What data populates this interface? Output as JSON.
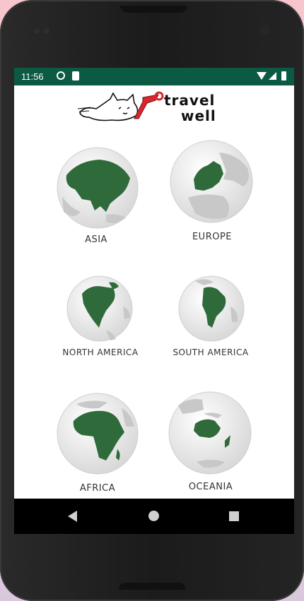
{
  "status_bar": {
    "time": "11:56"
  },
  "logo": {
    "line1": "travel",
    "line2": "well"
  },
  "continents": [
    {
      "id": "asia",
      "label": "ASIA"
    },
    {
      "id": "europe",
      "label": "EUROPE"
    },
    {
      "id": "north-america",
      "label": "NORTH AMERICA"
    },
    {
      "id": "south-america",
      "label": "SOUTH AMERICA"
    },
    {
      "id": "africa",
      "label": "AFRICA"
    },
    {
      "id": "oceania",
      "label": "OCEANIA"
    }
  ],
  "colors": {
    "status_bar": "#0b5a44",
    "land_highlight": "#2f6b3a",
    "land_gray": "#c8c8c8",
    "ocean": "#eeeeee"
  },
  "icons": [
    "back-icon",
    "home-icon",
    "recent-apps-icon",
    "wifi-icon",
    "cell-signal-icon",
    "battery-icon"
  ]
}
